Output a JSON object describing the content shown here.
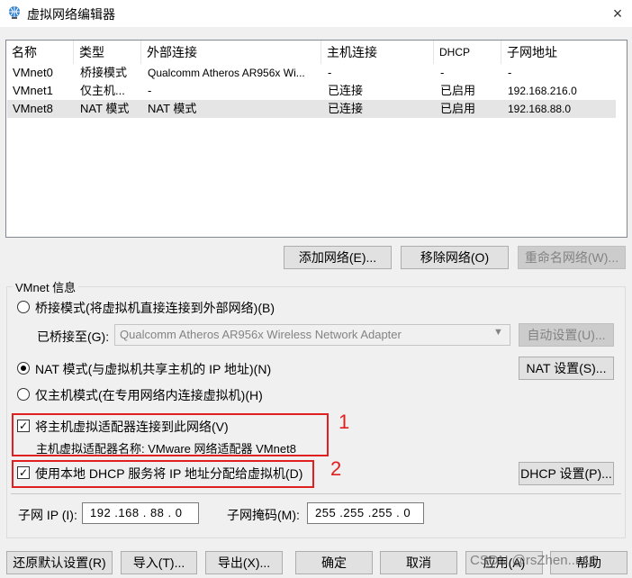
{
  "window": {
    "title": "虚拟网络编辑器",
    "close_icon": "×"
  },
  "table": {
    "headers": [
      "名称",
      "类型",
      "外部连接",
      "主机连接",
      "DHCP",
      "子网地址"
    ],
    "rows": [
      [
        "VMnet0",
        "桥接模式",
        "Qualcomm Atheros AR956x Wi...",
        "-",
        "-",
        "-"
      ],
      [
        "VMnet1",
        "仅主机...",
        "-",
        "已连接",
        "已启用",
        "192.168.216.0"
      ],
      [
        "VMnet8",
        "NAT 模式",
        "NAT 模式",
        "已连接",
        "已启用",
        "192.168.88.0"
      ]
    ],
    "selected_row": 2
  },
  "list_buttons": {
    "add": "添加网络(E)...",
    "remove": "移除网络(O)",
    "rename": "重命名网络(W)..."
  },
  "vmnet_info": {
    "group_label": "VMnet 信息",
    "bridge_mode": "桥接模式(将虚拟机直接连接到外部网络)(B)",
    "bridged_to_label": "已桥接至(G):",
    "bridged_to_value": "Qualcomm Atheros AR956x Wireless Network Adapter",
    "auto_settings": "自动设置(U)...",
    "nat_mode": "NAT 模式(与虚拟机共享主机的 IP 地址)(N)",
    "nat_settings": "NAT 设置(S)...",
    "host_only_mode": "仅主机模式(在专用网络内连接虚拟机)(H)",
    "connect_adapter": "将主机虚拟适配器连接到此网络(V)",
    "adapter_name": "主机虚拟适配器名称: VMware 网络适配器 VMnet8",
    "use_dhcp": "使用本地 DHCP 服务将 IP 地址分配给虚拟机(D)",
    "dhcp_settings": "DHCP 设置(P)...",
    "subnet_ip_label": "子网 IP (I):",
    "subnet_ip": "192 .168 . 88  .  0",
    "subnet_mask_label": "子网掩码(M):",
    "subnet_mask": "255 .255 .255 .  0",
    "selected_mode": "nat",
    "connect_adapter_checked": true,
    "use_dhcp_checked": true
  },
  "annotations": {
    "mark1": "1",
    "mark2": "2",
    "color": "#e02020"
  },
  "bottom_buttons": {
    "restore": "还原默认设置(R)",
    "import": "导入(T)...",
    "export": "导出(X)...",
    "ok": "确定",
    "cancel": "取消",
    "apply": "应用(A)",
    "help": "帮助"
  },
  "watermark": "CSDN @rsZhen..n16"
}
